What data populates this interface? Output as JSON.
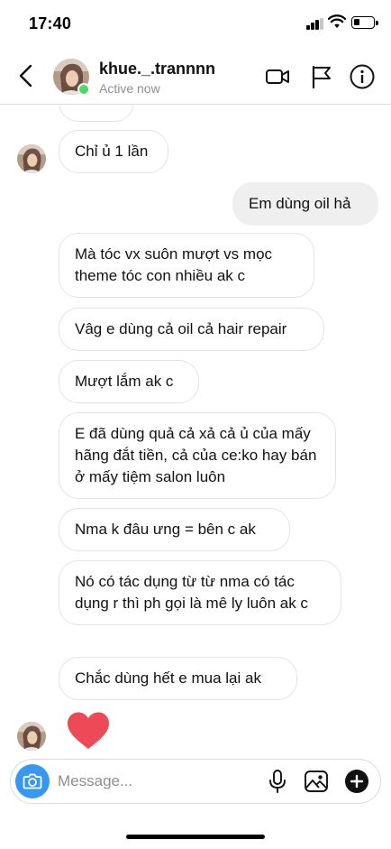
{
  "status_bar": {
    "time": "17:40"
  },
  "header": {
    "username": "khue._.trannnn",
    "status": "Active now"
  },
  "messages": [
    {
      "id": "m1",
      "side": "in",
      "text": "Chỉ ủ 1 lần"
    },
    {
      "id": "m2",
      "side": "out",
      "text": "Em dùng oil hả"
    },
    {
      "id": "m3",
      "side": "in",
      "text": "Mà tóc vx suôn mượt vs mọc theme tóc con nhiều ak c"
    },
    {
      "id": "m4",
      "side": "in",
      "text": "Vâg e dùng cả oil cả hair repair"
    },
    {
      "id": "m5",
      "side": "in",
      "text": "Mượt lắm ak c"
    },
    {
      "id": "m6",
      "side": "in",
      "text": "E  đã dùng quả cả xả cả ủ của mấy hãng đắt tiền, cả của ce:ko hay bán ở mấy tiệm salon luôn"
    },
    {
      "id": "m7",
      "side": "in",
      "text": "Nma k đâu ưng = bên c ak"
    },
    {
      "id": "m8",
      "side": "in",
      "text": "Nó có tác dụng từ từ nma có tác dụng r thì ph gọi là mê ly luôn ak c"
    },
    {
      "id": "m9",
      "side": "in",
      "text": "Chắc dùng hết e mua lại ak"
    }
  ],
  "reaction": {
    "icon": "heart-icon",
    "color": "#ed4956"
  },
  "composer": {
    "placeholder": "Message..."
  },
  "colors": {
    "accent": "#3897f0",
    "active": "#4cd964",
    "outgoing_bubble": "#efefef"
  }
}
